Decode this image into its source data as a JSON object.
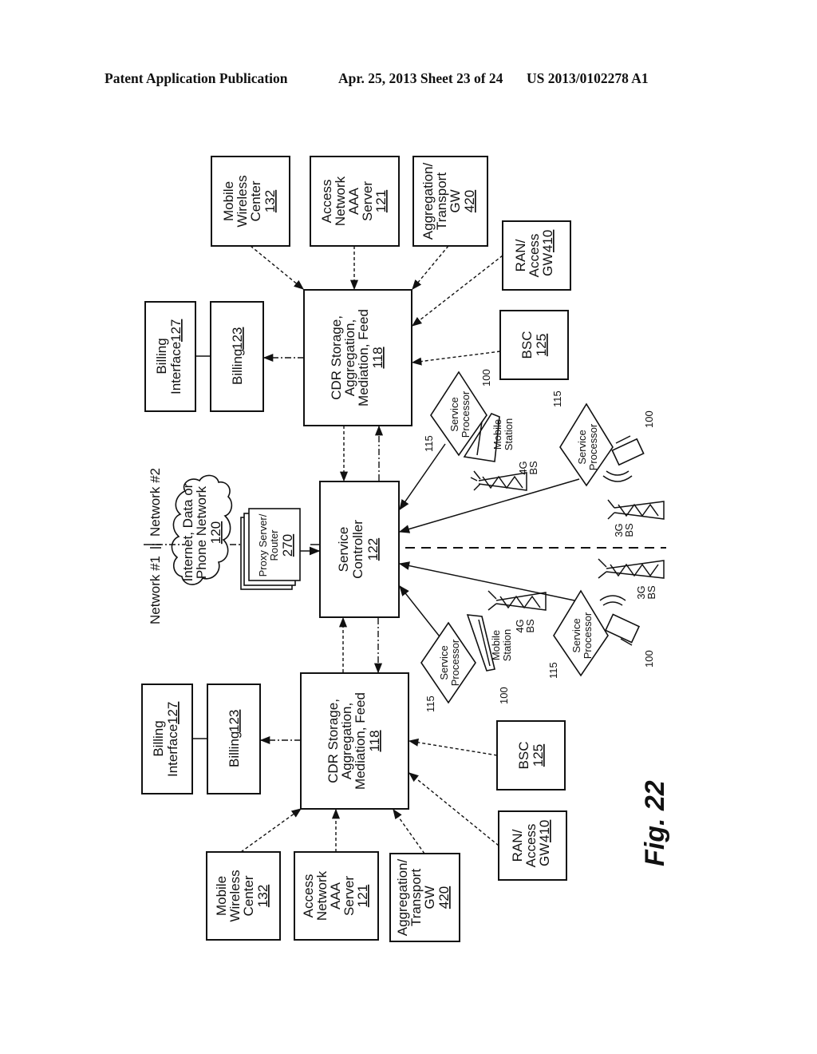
{
  "header": {
    "publication": "Patent Application Publication",
    "date_sheet": "Apr. 25, 2013  Sheet 23 of 24",
    "number": "US 2013/0102278 A1"
  },
  "figure": {
    "label": "Fig. 22",
    "network_divider": {
      "left": "Network #1",
      "right": "Network #2"
    },
    "cloud": {
      "lines": [
        "Internet, Data or",
        "Phone Network"
      ],
      "ref": "120"
    },
    "proxy": {
      "lines": [
        "Proxy Server/",
        "Router"
      ],
      "ref": "270"
    },
    "service_controller": {
      "lines": [
        "Service",
        "Controller"
      ],
      "ref": "122"
    },
    "network2": {
      "cdr": {
        "lines": [
          "CDR Storage,",
          "Aggregation,",
          "Mediation, Feed"
        ],
        "ref": "118"
      },
      "billing": {
        "label": "Billing",
        "ref": "123"
      },
      "billing_interface": {
        "lines": [
          "Billing",
          "Interface"
        ],
        "ref": "127"
      },
      "mobile_wireless_center": {
        "lines": [
          "Mobile",
          "Wireless",
          "Center"
        ],
        "ref": "132"
      },
      "aaa_server": {
        "lines": [
          "Access",
          "Network",
          "AAA",
          "Server"
        ],
        "ref": "121"
      },
      "transport_gw": {
        "lines": [
          "Aggregation/",
          "Transport",
          "GW"
        ],
        "ref": "420"
      },
      "ran_gw": {
        "lines": [
          "RAN/",
          "Access",
          "GW"
        ],
        "ref": "410"
      },
      "bsc": {
        "label": "BSC",
        "ref": "125"
      }
    },
    "network1": {
      "cdr": {
        "lines": [
          "CDR Storage,",
          "Aggregation,",
          "Mediation, Feed"
        ],
        "ref": "118"
      },
      "billing": {
        "label": "Billing",
        "ref": "123"
      },
      "billing_interface": {
        "lines": [
          "Billing",
          "Interface"
        ],
        "ref": "127"
      },
      "mobile_wireless_center": {
        "lines": [
          "Mobile",
          "Wireless",
          "Center"
        ],
        "ref": "132"
      },
      "aaa_server": {
        "lines": [
          "Access",
          "Network",
          "AAA",
          "Server"
        ],
        "ref": "121"
      },
      "transport_gw": {
        "lines": [
          "Aggregation/",
          "Transport",
          "GW"
        ],
        "ref": "420"
      },
      "ran_gw": {
        "lines": [
          "RAN/",
          "Access",
          "GW"
        ],
        "ref": "410"
      },
      "bsc": {
        "label": "BSC",
        "ref": "125"
      }
    },
    "service_processor": {
      "lines": [
        "Service",
        "Processor"
      ],
      "ref": "115"
    },
    "mobile_station": {
      "lines": [
        "Mobile",
        "Station"
      ],
      "ref": "100"
    },
    "device_ref": "100",
    "bs_4g": [
      "4G",
      "BS"
    ],
    "bs_3g": [
      "3G",
      "BS"
    ]
  }
}
